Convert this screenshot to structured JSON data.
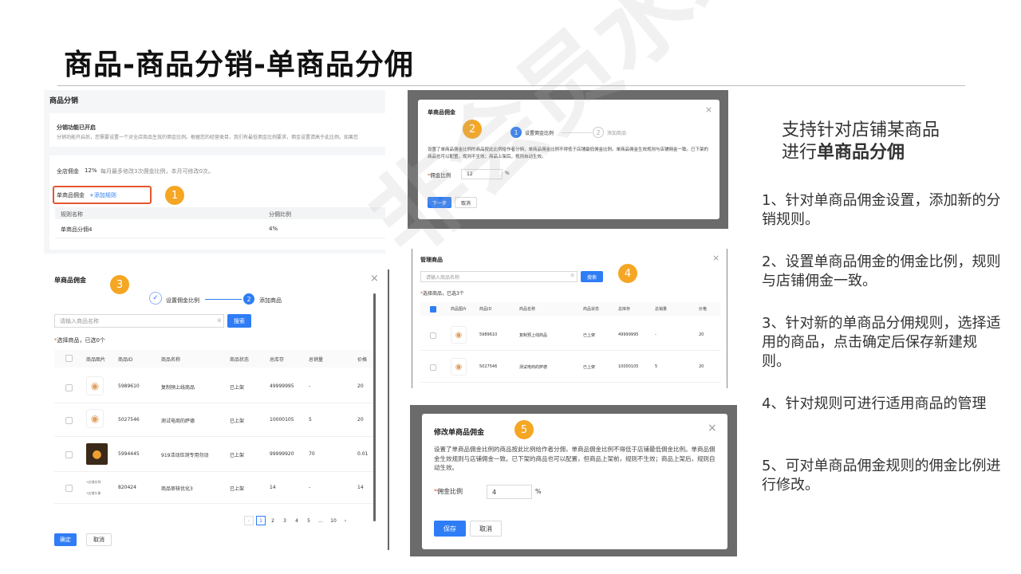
{
  "slide": {
    "title": "商品-商品分销-单商品分佣",
    "watermark": "非会员水印"
  },
  "panel1": {
    "heading": "商品分销",
    "notice_title": "分销功能已开启",
    "notice_text": "分销功能开启后，您需要设置一个对全店商品生效的佣金比例。根据您的经营类目，我们有最低佣金比例要求，佣金设置请高于此比例。如果您",
    "store_label": "全店佣金",
    "store_value": "12%",
    "store_note": "每月最多修改3次佣金比例，本月可修改0次。",
    "single_label": "单商品佣金",
    "add_rule": "+添加规则",
    "badge": "1",
    "col_rule": "规则名称",
    "col_ratio": "分佣比例",
    "row_rule": "单商品分佣4",
    "row_ratio": "4%"
  },
  "panel2": {
    "title": "单商品佣金",
    "badge": "2",
    "step1": "设置佣金比例",
    "step1_num": "1",
    "step2": "添加商品",
    "step2_num": "2",
    "desc": "设置了单商品佣金比例的商品按此比例给作者分佣，单商品佣金比例不得低于店铺最低佣金比例。单商品佣金生效规则与店铺佣金一致。已下架的商品也可以配置，规则不生效；商品上架后，规则自动生效。",
    "ratio_label": "佣金比例",
    "ratio_value": "12",
    "unit": "%",
    "next": "下一步",
    "cancel": "取消"
  },
  "panel3": {
    "title": "单商品佣金",
    "badge": "3",
    "step1": "设置佣金比例",
    "step2": "添加商品",
    "step2_num": "2",
    "search_placeholder": "请输入商品名称",
    "search_btn": "搜索",
    "selected": "选择商品，已选0个",
    "headers": [
      "商品图片",
      "商品ID",
      "商品名称",
      "商品状态",
      "总库存",
      "总销量",
      "价格"
    ],
    "rows": [
      {
        "id": "5989610",
        "name": "复制预上线商品",
        "status": "已上架",
        "stock": "49999995",
        "sales": "-",
        "price": "20"
      },
      {
        "id": "5027546",
        "name": "测试电商的萨德",
        "status": "已上架",
        "stock": "10000105",
        "sales": "5",
        "price": "20"
      },
      {
        "id": "5994445",
        "name": "919活动压测专用勿动",
        "status": "已上架",
        "stock": "99999920",
        "sales": "70",
        "price": "0.01"
      },
      {
        "id": "820424",
        "name": "商品审核优化3",
        "status": "已上架",
        "stock": "14",
        "sales": "-",
        "price": "14"
      }
    ],
    "img_caption_1": "•店铺名称",
    "img_caption_2": "•店铺头像",
    "pages": [
      "1",
      "2",
      "3",
      "4",
      "5",
      "...",
      "10"
    ],
    "ok": "确定",
    "cancel": "取消"
  },
  "panel4": {
    "title": "管理商品",
    "badge": "4",
    "search_placeholder": "请输入商品名称",
    "search_btn": "搜索",
    "selected": "选择商品，已选3个",
    "headers": [
      "商品图片",
      "商品ID",
      "商品名称",
      "商品状态",
      "总库存",
      "总销量",
      "价格"
    ],
    "rows": [
      {
        "id": "5989610",
        "name": "复制预上线商品",
        "status": "已上架",
        "stock": "49999995",
        "sales": "-",
        "price": "20"
      },
      {
        "id": "5027546",
        "name": "测试电商的萨德",
        "status": "已上架",
        "stock": "10000105",
        "sales": "5",
        "price": "20"
      }
    ]
  },
  "panel5": {
    "title": "修改单商品佣金",
    "badge": "5",
    "desc": "设置了单商品佣金比例的商品按此比例给作者分佣，单商品佣金比例不得低于店铺最低佣金比例。单商品佣金生效规则与店铺佣金一致。已下架的商品也可以配置，但商品上架前，规则不生效；商品上架后，规则自动生效。",
    "ratio_label": "佣金比例",
    "ratio_value": "4",
    "unit": "%",
    "save": "保存",
    "cancel": "取消"
  },
  "right": {
    "heading_1": "支持针对店铺某商品",
    "heading_2a": "进行",
    "heading_2b": "单商品分佣",
    "p1": "1、针对单商品佣金设置，添加新的分销规则。",
    "p2": "2、设置单商品佣金的佣金比例，规则与店铺佣金一致。",
    "p3": "3、针对新的单商品分佣规则，选择适用的商品，点击确定后保存新建规则。",
    "p4": "4、针对规则可进行适用商品的管理",
    "p5": "5、可对单商品佣金规则的佣金比例进行修改。"
  },
  "colors": {
    "accent": "#2f7df6",
    "badge": "#f5a623",
    "highlight": "#e4572e"
  }
}
